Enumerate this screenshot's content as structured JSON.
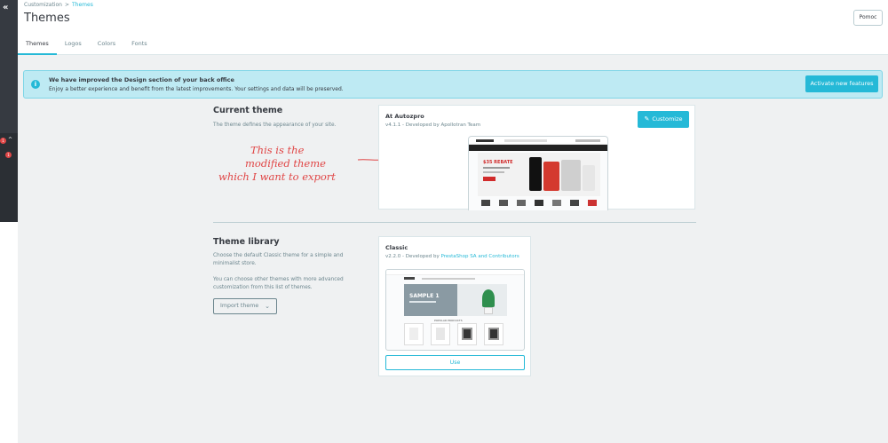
{
  "breadcrumb": {
    "parent": "Customization",
    "separator": ">",
    "current": "Themes"
  },
  "page": {
    "title": "Themes",
    "help_label": "Pomoc"
  },
  "tabs": [
    {
      "label": "Themes",
      "active": true
    },
    {
      "label": "Logos",
      "active": false
    },
    {
      "label": "Colors",
      "active": false
    },
    {
      "label": "Fonts",
      "active": false
    }
  ],
  "sidebar": {
    "collapse_glyph": "«",
    "badge_1": "1",
    "badge_2": "1"
  },
  "alert": {
    "title": "We have improved the Design section of your back office",
    "text": "Enjoy a better experience and benefit from the latest improvements. Your settings and data will be preserved.",
    "button": "Activate new features"
  },
  "current_theme": {
    "heading": "Current theme",
    "description": "The theme defines the appearance of your site.",
    "name": "At Autozpro",
    "version_text": "v4.1.1 - Developed by Apollotran Team",
    "customize_label": "Customize",
    "preview_banner": "$35 REBATE"
  },
  "annotation": {
    "line1": "This is the",
    "line2": "modified theme",
    "line3": "which I want to export"
  },
  "theme_library": {
    "heading": "Theme library",
    "description1": "Choose the default Classic theme for a simple and minimalist store.",
    "description2": "You can choose other themes with more advanced customization from this list of themes.",
    "import_label": "Import theme",
    "theme_name": "Classic",
    "version_prefix": "v2.2.0 - Developed by ",
    "developer": "PrestaShop SA and Contributors",
    "use_label": "Use",
    "preview_banner": "SAMPLE 1",
    "preview_section": "POPULAR PRODUCTS"
  },
  "colors": {
    "accent": "#25b9d7",
    "sidebar": "#363a41",
    "alert_bg": "#beeaf3",
    "annotation": "#e04545"
  },
  "icons": {
    "info": "info-icon",
    "pencil": "pencil-icon",
    "chevron": "chevron-down-icon"
  }
}
